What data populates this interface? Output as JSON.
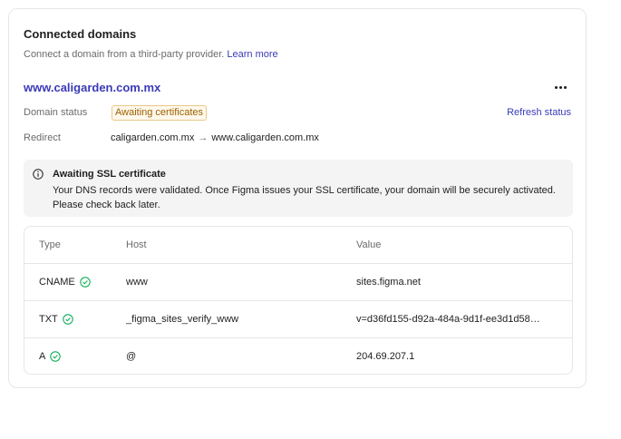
{
  "header": {
    "title": "Connected domains",
    "subtitle": "Connect a domain from a third-party provider.",
    "learn_more": "Learn more"
  },
  "domain": {
    "name": "www.caligarden.com.mx",
    "status_label": "Domain status",
    "status_badge": "Awaiting certificates",
    "refresh_label": "Refresh status",
    "redirect_label": "Redirect",
    "redirect_from": "caligarden.com.mx",
    "redirect_arrow": "→",
    "redirect_to": "www.caligarden.com.mx"
  },
  "alert": {
    "icon": "info-icon",
    "title": "Awaiting SSL certificate",
    "body": "Your DNS records were validated. Once Figma issues your SSL certificate, your domain will be securely activated. Please check back later."
  },
  "table": {
    "headers": {
      "type": "Type",
      "host": "Host",
      "value": "Value"
    },
    "rows": [
      {
        "type": "CNAME",
        "host": "www",
        "value": "sites.figma.net",
        "verified": true
      },
      {
        "type": "TXT",
        "host": "_figma_sites_verify_www",
        "value": "v=d36fd155-d92a-484a-9d1f-ee3d1d58…",
        "verified": true
      },
      {
        "type": "A",
        "host": "@",
        "value": "204.69.207.1",
        "verified": true
      }
    ]
  },
  "colors": {
    "accent": "#3a3ab8",
    "badge_text": "#9a6100",
    "success": "#14ae5c"
  }
}
